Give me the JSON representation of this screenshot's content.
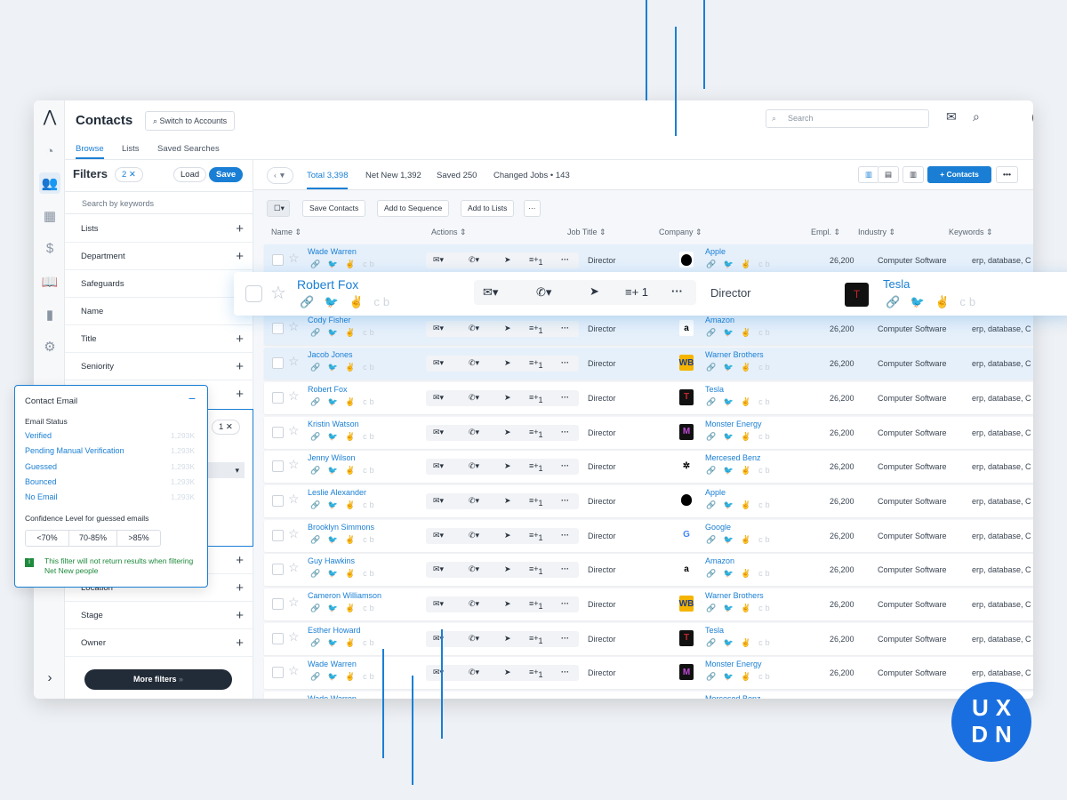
{
  "header": {
    "title": "Contacts",
    "switch_label": "Switch to Accounts",
    "tabs": [
      "Browse",
      "Lists",
      "Saved Searches"
    ],
    "search_placeholder": "Search"
  },
  "filters": {
    "title": "Filters",
    "count": "2 ✕",
    "load": "Load",
    "save": "Save",
    "search_placeholder": "Search by keywords",
    "items": [
      "Lists",
      "Department",
      "Safeguards",
      "Name",
      "Title",
      "Seniority"
    ],
    "items_bottom": [
      "Location",
      "Stage",
      "Owner"
    ],
    "active_count": "1 ✕",
    "more": "More filters"
  },
  "popover": {
    "title": "Contact Email",
    "status_label": "Email Status",
    "statuses": [
      {
        "label": "Verified",
        "count": "1,293K"
      },
      {
        "label": "Pending Manual Verification",
        "count": "1,293K"
      },
      {
        "label": "Guessed",
        "count": "1,293K"
      },
      {
        "label": "Bounced",
        "count": "1,293K"
      },
      {
        "label": "No Email",
        "count": "1,293K"
      }
    ],
    "confidence_label": "Confidence Level for guessed emails",
    "confidence": [
      "<70%",
      "70-85%",
      ">85%"
    ],
    "note": "This filter will not return results when filtering Net New people"
  },
  "main": {
    "tabs": [
      "Total 3,398",
      "Net New 1,392",
      "Saved 250",
      "Changed Jobs • 143"
    ],
    "add_contacts": "+ Contacts",
    "bulk": [
      "Save Contacts",
      "Add to Sequence",
      "Add to Lists"
    ],
    "columns": [
      "Name",
      "Actions",
      "Job Title",
      "Company",
      "Empl.",
      "Industry",
      "Keywords"
    ]
  },
  "rows": [
    {
      "name": "Wade Warren",
      "company": "Apple",
      "logo": "apple"
    },
    {
      "name": "Cody Fisher",
      "company": "Amazon",
      "logo": "amazon"
    },
    {
      "name": "Jacob Jones",
      "company": "Warner Brothers",
      "logo": "wb"
    },
    {
      "name": "Robert Fox",
      "company": "Tesla",
      "logo": "tesla"
    },
    {
      "name": "Kristin Watson",
      "company": "Monster Energy",
      "logo": "monster"
    },
    {
      "name": "Jenny Wilson",
      "company": "Mercesed Benz",
      "logo": "mercedes"
    },
    {
      "name": "Leslie Alexander",
      "company": "Apple",
      "logo": "apple"
    },
    {
      "name": "Brooklyn Simmons",
      "company": "Google",
      "logo": "google"
    },
    {
      "name": "Guy Hawkins",
      "company": "Amazon",
      "logo": "amazon"
    },
    {
      "name": "Cameron Williamson",
      "company": "Warner Brothers",
      "logo": "wb"
    },
    {
      "name": "Esther Howard",
      "company": "Tesla",
      "logo": "tesla"
    },
    {
      "name": "Wade Warren",
      "company": "Monster Energy",
      "logo": "monster"
    },
    {
      "name": "Wade Warren",
      "company": "Mercesed Benz",
      "logo": "mercedes"
    }
  ],
  "row_common": {
    "job_title": "Director",
    "employees": "26,200",
    "industry": "Computer Software",
    "keywords": "erp, database, C",
    "sequence_count": "1",
    "social": "🔗 🐦 ✌ cb"
  },
  "floating_row": {
    "name": "Robert Fox",
    "job_title": "Director",
    "company": "Tesla"
  },
  "badge": {
    "line1": "UX",
    "line2": "DN"
  },
  "colors": {
    "accent": "#1a7fd4",
    "success": "#1e8a3c",
    "dark": "#222b38"
  }
}
